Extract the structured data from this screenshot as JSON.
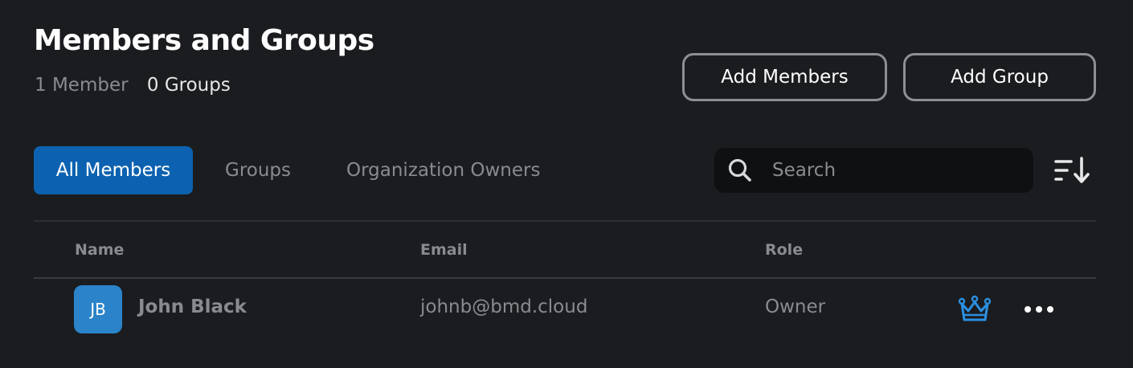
{
  "header": {
    "title": "Members and Groups",
    "member_count": "1 Member",
    "group_count": "0 Groups"
  },
  "actions": {
    "add_members_label": "Add Members",
    "add_group_label": "Add Group"
  },
  "tabs": [
    {
      "label": "All Members",
      "active": true
    },
    {
      "label": "Groups",
      "active": false
    },
    {
      "label": "Organization Owners",
      "active": false
    }
  ],
  "search": {
    "placeholder": "Search",
    "value": ""
  },
  "table": {
    "columns": [
      "Name",
      "Email",
      "Role"
    ],
    "rows": [
      {
        "initials": "JB",
        "name": "John Black",
        "email": "johnb@bmd.cloud",
        "role": "Owner",
        "role_icon": "crown-icon"
      }
    ]
  },
  "colors": {
    "background": "#1b1c1f",
    "accent": "#0c62b0",
    "avatar": "#2b83c9",
    "crown": "#2b8fe0",
    "muted_text": "#8a8b8f"
  },
  "icons": {
    "search": "search-icon",
    "sort": "sort-descending-icon",
    "more": "more-options-icon"
  }
}
